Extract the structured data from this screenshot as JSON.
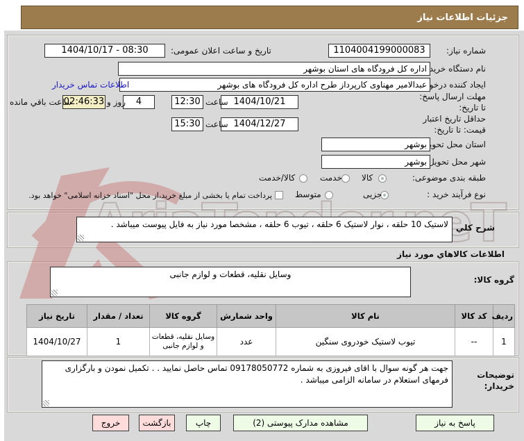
{
  "window": {
    "title": "جزئیات اطلاعات نیاز"
  },
  "colors": {
    "title_bar_bg": "#9c7b4c",
    "link": "#1a16c9",
    "countdown_bg": "#f3eec3",
    "button_green_bg": "#edfbe7",
    "button_pink_bg": "#ffdcdc",
    "watermark_red": "#c24b4b",
    "watermark_gray": "#a59595",
    "panel_bg": "#d9d9d9",
    "table_header_bg": "#c6c6c6"
  },
  "form": {
    "need_number_label": "شماره نیاز:",
    "need_number": "1104004199000083",
    "announce_label": "تاریخ و ساعت اعلان عمومی:",
    "announce_value": "1404/10/17 - 08:30",
    "buyer_org_label": "نام دستگاه خریدار:",
    "buyer_org": "اداره کل فرودگاه های استان بوشهر",
    "creator_label": "ایجاد کننده درخواست:",
    "creator": "عبدالامیر مهناوی کارپرداز طرح اداره کل فرودگاه های بوشهر",
    "buyer_contact_link": "اطلاعات تماس خریدار",
    "deadline_label": "مهلت ارسال پاسخ: تا تاریخ:",
    "deadline_date": "1404/10/21",
    "hour_label": "ساعت",
    "deadline_time": "12:30",
    "remaining_days": "4",
    "remaining_days_label": "روز و",
    "remaining_time": "02:46:33",
    "remaining_suffix_label": "ساعت باقي مانده",
    "price_validity_label": "حداقل تاریخ اعتبار قیمت: تا تاریخ:",
    "price_validity_date": "1404/12/27",
    "price_validity_time": "15:30",
    "province_label": "استان محل تحویل:",
    "province": "بوشهر",
    "city_label": "شهر محل تحویل:",
    "city": "بوشهر",
    "subject_label": "طبقه بندی موضوعی:",
    "subject_options": [
      {
        "label": "کالا",
        "selected": true
      },
      {
        "label": "خدمت",
        "selected": false
      },
      {
        "label": "کالا/خدمت",
        "selected": false
      }
    ],
    "process_label": "نوع فرآیند خرید :",
    "process_options": [
      {
        "label": "جزیی",
        "selected": true
      },
      {
        "label": "متوسط",
        "selected": false
      }
    ],
    "treasury_checkbox_label": "پرداخت تمام یا بخشی از مبلغ خرید،از محل \"اسناد خزانه اسلامی\" خواهد بود.",
    "treasury_checkbox_checked": false
  },
  "need_summary": {
    "label": "شرح كلي نياز:",
    "value": "لاستیک 10 حلقه ، نوار لاستیک 6  حلقه  ، تیوب 6 حلقه  ، مشخصا مورد نیاز به فایل پیوست میباشد ."
  },
  "goods": {
    "section_header": "اطلاعات كالاهاي مورد نياز",
    "group_label": "گروه کالا:",
    "group_value": "وسایل نقلیه، قطعات و لوازم جانبی",
    "table": {
      "headers": [
        "ردیف",
        "کد کالا",
        "نام کالا",
        "واحد شمارش",
        "گروه کالا",
        "تعداد / مقدار",
        "تاریخ نیاز"
      ],
      "rows": [
        [
          "1",
          "--",
          "تیوب لاستیک خودروی سنگین",
          "عدد",
          "وسایل نقلیه، قطعات و لوازم جانبی",
          "1",
          "1404/10/27"
        ]
      ]
    }
  },
  "buyer_notes": {
    "label": "توضیحات خریدار:",
    "value": "جهت هر گونه سوال با اقای فیروزی به شماره 09178050772 تماس حاصل نمایید . . تکمیل نمودن و بارگزاری فرمهای استعلام در سامانه الزامی میباشد ."
  },
  "buttons": {
    "reply": "پاسخ به نیاز",
    "view_attachments": "مشاهده مدارک پیوستی (2)",
    "print": "چاپ",
    "back": "بازگشت",
    "exit": "خروج"
  },
  "watermark": {
    "text": "AriaTender.neT"
  }
}
